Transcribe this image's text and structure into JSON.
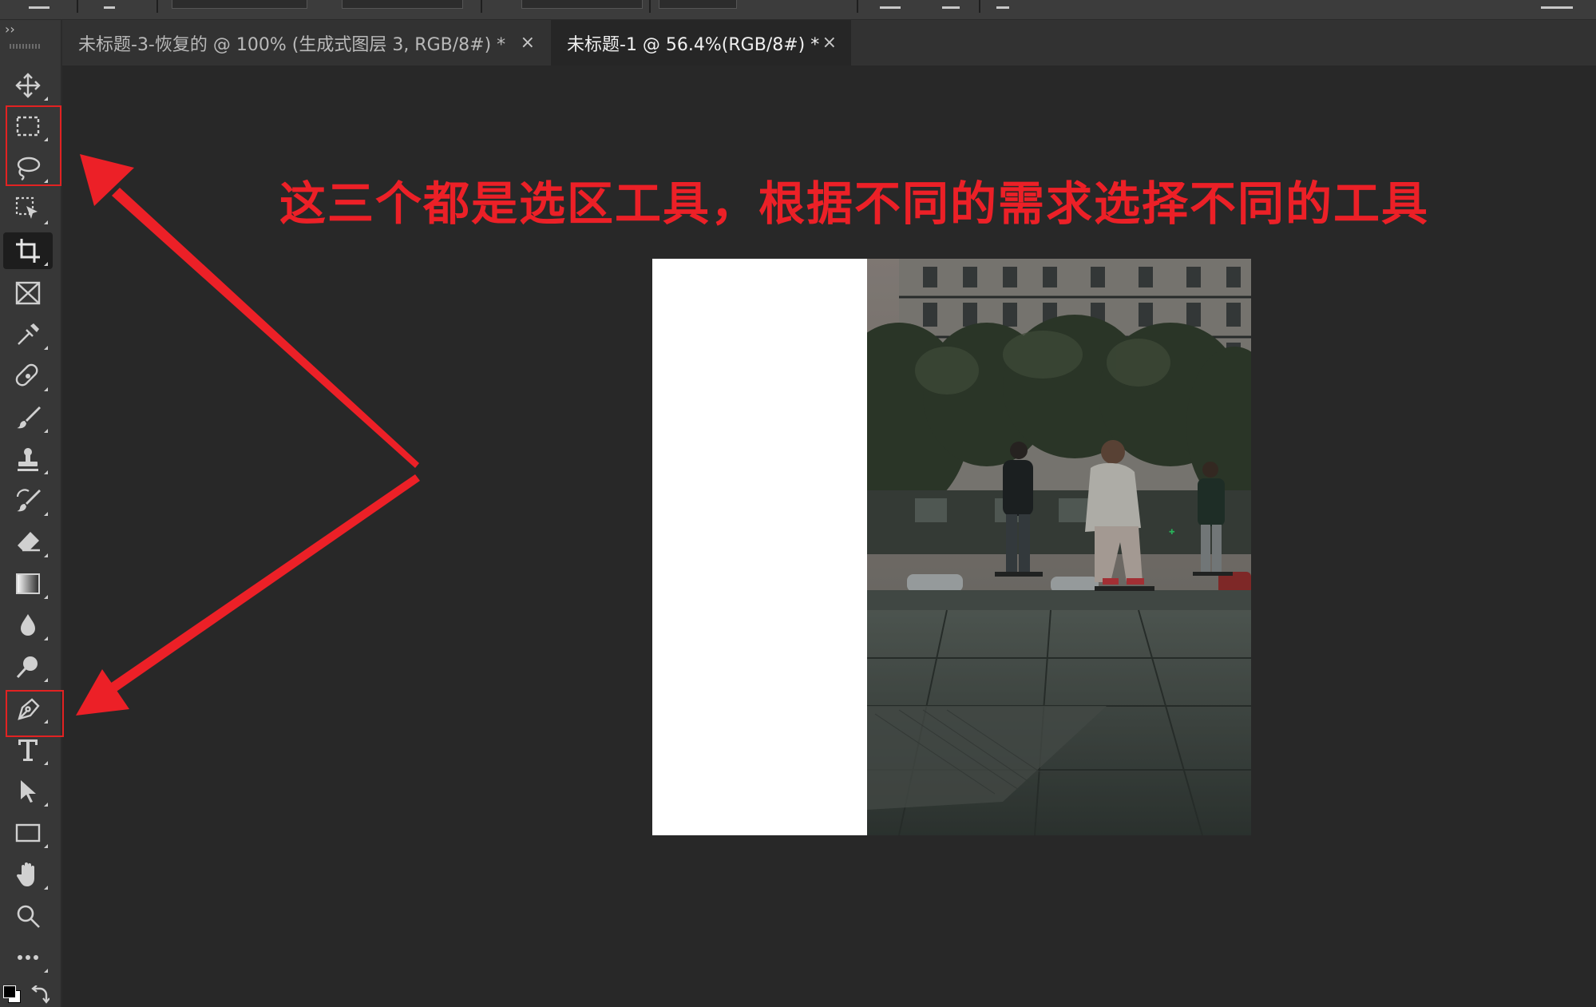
{
  "tabs": [
    {
      "label": "未标题-3-恢复的 @ 100% (生成式图层 3, RGB/8#) *",
      "close": "×",
      "active": false
    },
    {
      "label": "未标题-1 @ 56.4%(RGB/8#) *",
      "close": "×",
      "active": true
    }
  ],
  "toolbar": {
    "collapse": "››",
    "tools": [
      {
        "name": "move-tool",
        "icon": "move-icon"
      },
      {
        "name": "rectangular-marquee-tool",
        "icon": "marquee-icon"
      },
      {
        "name": "lasso-tool",
        "icon": "lasso-icon"
      },
      {
        "name": "object-selection-tool",
        "icon": "object-selection-icon"
      },
      {
        "name": "crop-tool",
        "icon": "crop-icon",
        "active": true
      },
      {
        "name": "frame-tool",
        "icon": "frame-icon"
      },
      {
        "name": "eyedropper-tool",
        "icon": "eyedropper-icon"
      },
      {
        "name": "healing-brush-tool",
        "icon": "bandage-icon"
      },
      {
        "name": "brush-tool",
        "icon": "brush-icon"
      },
      {
        "name": "clone-stamp-tool",
        "icon": "stamp-icon"
      },
      {
        "name": "history-brush-tool",
        "icon": "history-brush-icon"
      },
      {
        "name": "eraser-tool",
        "icon": "eraser-icon"
      },
      {
        "name": "gradient-tool",
        "icon": "gradient-icon"
      },
      {
        "name": "blur-tool",
        "icon": "droplet-icon"
      },
      {
        "name": "dodge-tool",
        "icon": "dodge-icon"
      },
      {
        "name": "pen-tool",
        "icon": "pen-icon"
      },
      {
        "name": "type-tool",
        "icon": "type-icon"
      },
      {
        "name": "path-selection-tool",
        "icon": "arrow-cursor-icon"
      },
      {
        "name": "rectangle-tool",
        "icon": "rectangle-icon"
      },
      {
        "name": "hand-tool",
        "icon": "hand-icon"
      },
      {
        "name": "zoom-tool",
        "icon": "magnifier-icon"
      },
      {
        "name": "edit-toolbar",
        "icon": "more-icon"
      }
    ]
  },
  "annotation": {
    "text": "这三个都是选区工具，根据不同的需求选择不同的工具",
    "color": "#ec2027"
  },
  "canvas": {
    "background": "#ffffff"
  }
}
